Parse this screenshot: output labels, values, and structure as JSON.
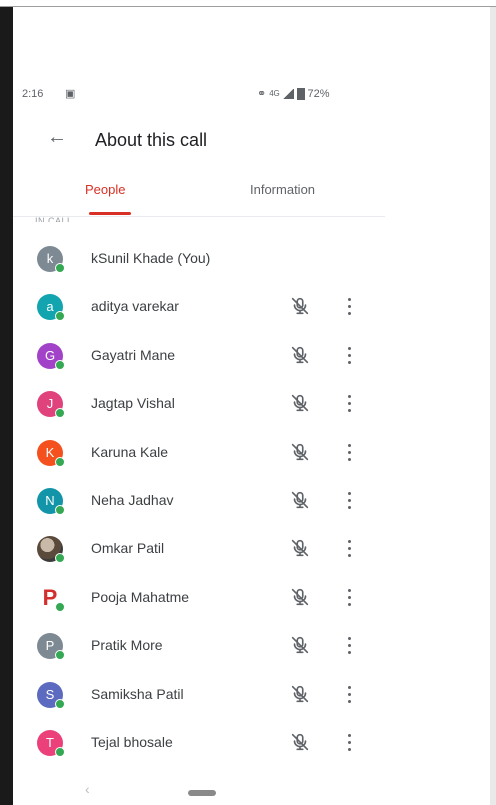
{
  "status_bar": {
    "time": "2:16",
    "network": "4G",
    "battery": "72%"
  },
  "header": {
    "title": "About this call"
  },
  "tabs": [
    {
      "label": "People",
      "active": true
    },
    {
      "label": "Information",
      "active": false
    }
  ],
  "section_label": "IN CALL",
  "participants": [
    {
      "name": "kSunil Khade (You)",
      "initial": "k",
      "color": "#7d8a93",
      "mic_icon": null
    },
    {
      "name": "aditya varekar",
      "initial": "a",
      "color": "#12a4af",
      "mic_icon": "mic-off-icon"
    },
    {
      "name": "Gayatri Mane",
      "initial": "G",
      "color": "#a142c9",
      "mic_icon": "mic-off-icon"
    },
    {
      "name": "Jagtap Vishal",
      "initial": "J",
      "color": "#e0427c",
      "mic_icon": "mic-off-icon"
    },
    {
      "name": "Karuna Kale",
      "initial": "K",
      "color": "#f4511e",
      "mic_icon": "mic-off-icon"
    },
    {
      "name": "Neha Jadhav",
      "initial": "N",
      "color": "#1295a8",
      "mic_icon": "mic-off-icon"
    },
    {
      "name": "Omkar Patil",
      "initial": "",
      "color": "#5a4a3c",
      "mic_icon": "mic-off-icon"
    },
    {
      "name": "Pooja Mahatme",
      "initial": "P",
      "color": "#d32f2f",
      "mic_icon": "mic-off-icon"
    },
    {
      "name": "Pratik More",
      "initial": "P",
      "color": "#7d8a93",
      "mic_icon": "mic-off-icon"
    },
    {
      "name": "Samiksha Patil",
      "initial": "S",
      "color": "#5c6bc0",
      "mic_icon": "mic-off-icon"
    },
    {
      "name": "Tejal bhosale",
      "initial": "T",
      "color": "#ec407a",
      "mic_icon": "mic-off-icon"
    }
  ],
  "colors": {
    "accent": "#d93025",
    "online": "#34a853"
  }
}
